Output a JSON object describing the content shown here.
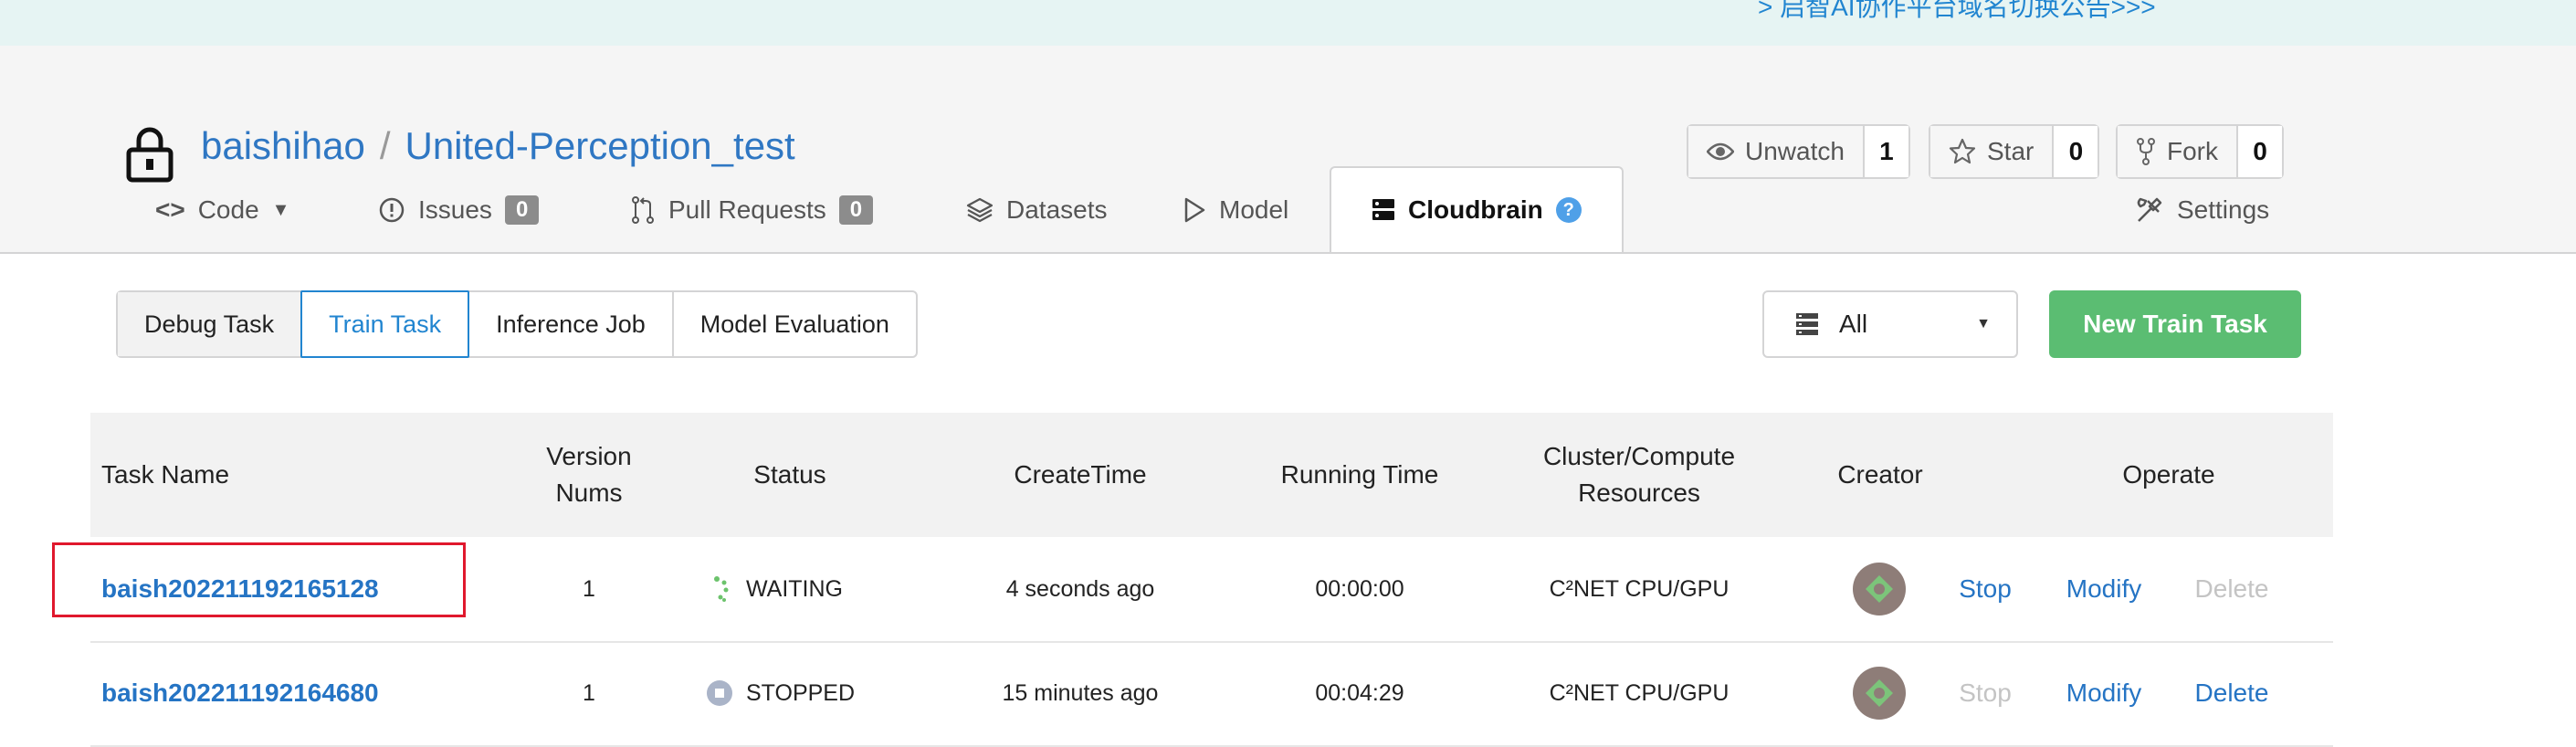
{
  "announcement": "> 启智AI协作平台域名切换公告>>>",
  "repo": {
    "owner": "baishihao",
    "separator": "/",
    "name": "United-Perception_test"
  },
  "repo_buttons": {
    "watch": {
      "label": "Unwatch",
      "count": "1"
    },
    "star": {
      "label": "Star",
      "count": "0"
    },
    "fork": {
      "label": "Fork",
      "count": "0"
    }
  },
  "tabs": {
    "code": "Code",
    "issues": {
      "label": "Issues",
      "count": "0"
    },
    "pulls": {
      "label": "Pull Requests",
      "count": "0"
    },
    "datasets": "Datasets",
    "model": "Model",
    "cloudbrain": "Cloudbrain",
    "help": "?",
    "settings": "Settings"
  },
  "task_types": [
    "Debug Task",
    "Train Task",
    "Inference Job",
    "Model Evaluation"
  ],
  "filter": {
    "value": "All"
  },
  "new_task_button": "New Train Task",
  "table": {
    "headers": {
      "task_name": "Task Name",
      "version_nums": "Version Nums",
      "status": "Status",
      "create_time": "CreateTime",
      "running_time": "Running Time",
      "cluster": "Cluster/Compute Resources",
      "creator": "Creator",
      "operate": "Operate"
    },
    "rows": [
      {
        "name": "baish202211192165128",
        "version": "1",
        "status": "WAITING",
        "create_time": "4 seconds ago",
        "running_time": "00:00:00",
        "cluster": "C²NET CPU/GPU",
        "stop": "Stop",
        "modify": "Modify",
        "delete": "Delete"
      },
      {
        "name": "baish202211192164680",
        "version": "1",
        "status": "STOPPED",
        "create_time": "15 minutes ago",
        "running_time": "00:04:29",
        "cluster": "C²NET CPU/GPU",
        "stop": "Stop",
        "modify": "Modify",
        "delete": "Delete"
      }
    ]
  },
  "colors": {
    "accent": "#2185d0",
    "primary_button": "#5bbd72",
    "highlight_box": "#e0182d"
  }
}
